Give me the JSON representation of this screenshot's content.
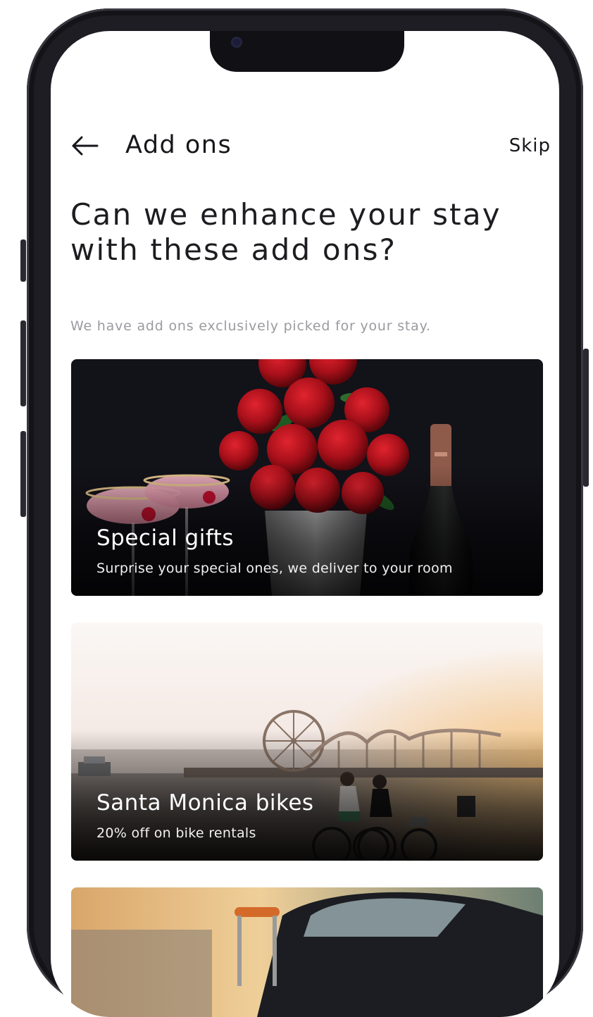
{
  "header": {
    "title": "Add ons",
    "skip_label": "Skip",
    "back_icon": "arrow-left-icon"
  },
  "headline": {
    "line1": "Can we enhance your stay",
    "line2": "with these add ons?"
  },
  "subtext": "We have add ons exclusively picked for your stay.",
  "cards": [
    {
      "title": "Special gifts",
      "subtitle": "Surprise your special ones, we deliver to your room"
    },
    {
      "title": "Santa Monica bikes",
      "subtitle": "20% off on bike rentals"
    },
    {
      "title": "",
      "subtitle": ""
    }
  ],
  "colors": {
    "text_primary": "#17171b",
    "text_muted": "#9a9aa0",
    "phone_frame": "#1e1d24",
    "screen_bg": "#ffffff"
  }
}
